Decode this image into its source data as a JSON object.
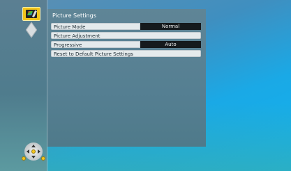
{
  "panel": {
    "title": "Picture Settings",
    "rows": [
      {
        "label": "Picture Mode",
        "value": "Normal"
      },
      {
        "label": "Picture Adjustment"
      },
      {
        "label": "Progressive",
        "value": "Auto"
      },
      {
        "label": "Reset to Default Picture Settings"
      }
    ]
  },
  "sidebar": {
    "items": [
      {
        "icon": "picture-palette-icon",
        "selected": true
      },
      {
        "icon": "cube-icon",
        "selected": false
      }
    ]
  },
  "navpad": {
    "icon": "directional-pad-icon"
  },
  "colors": {
    "accent": "#f3c41a",
    "value_bg": "#151a1d",
    "row_bg": "#e4eaec"
  }
}
